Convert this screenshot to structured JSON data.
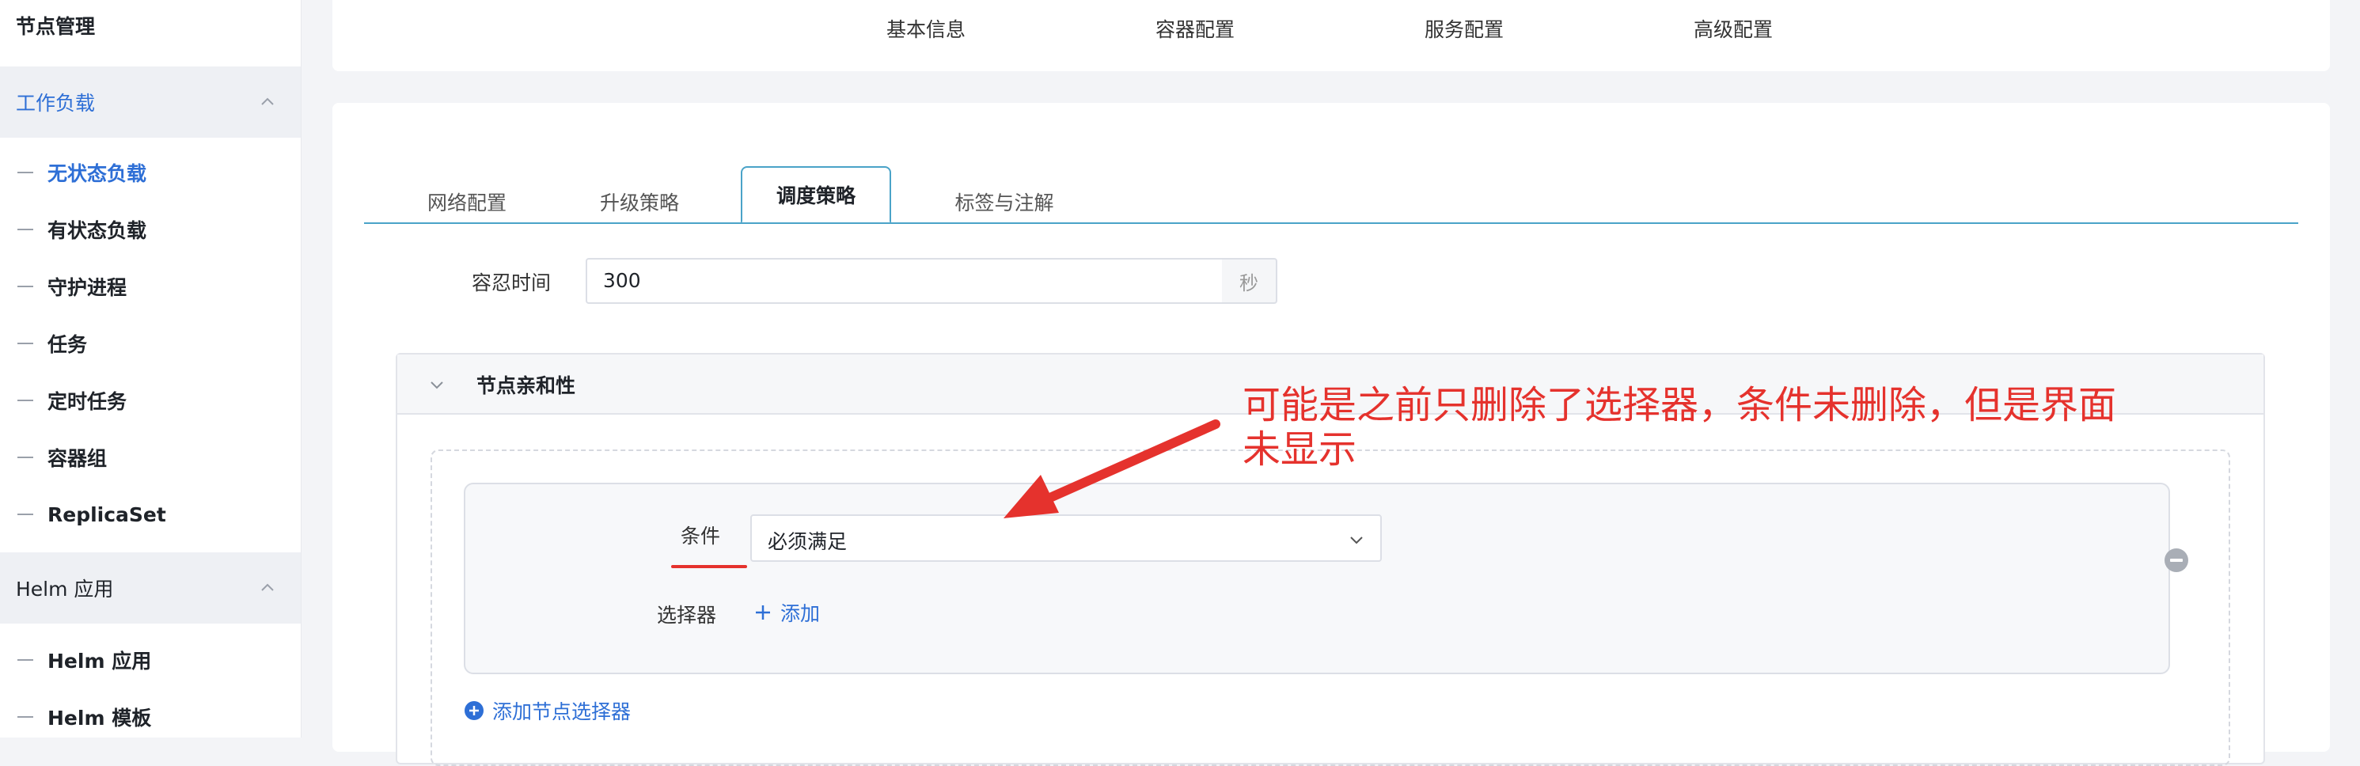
{
  "sidebar": {
    "top_item": "节点管理",
    "group_workload": "工作负载",
    "workload_items": [
      "无状态负载",
      "有状态负载",
      "守护进程",
      "任务",
      "定时任务",
      "容器组",
      "ReplicaSet"
    ],
    "group_helm": "Helm 应用",
    "helm_items": [
      "Helm 应用",
      "Helm 模板"
    ]
  },
  "top_tabs": [
    "基本信息",
    "容器配置",
    "服务配置",
    "高级配置"
  ],
  "sub_tabs": [
    "网络配置",
    "升级策略",
    "调度策略",
    "标签与注解"
  ],
  "active_sub_tab": "调度策略",
  "tolerance": {
    "label": "容忍时间",
    "value": "300",
    "unit": "秒"
  },
  "affinity": {
    "title": "节点亲和性",
    "condition_label": "条件",
    "condition_value": "必须满足",
    "selector_label": "选择器",
    "add_label": "添加",
    "add_node_selector": "添加节点选择器"
  },
  "annotation": {
    "line1": "可能是之前只删除了选择器，条件未删除，但是界面",
    "line2": "未显示"
  },
  "colors": {
    "accent": "#2e6fd6",
    "tab_border": "#4aa3c8",
    "annotation_red": "#e5322d"
  }
}
